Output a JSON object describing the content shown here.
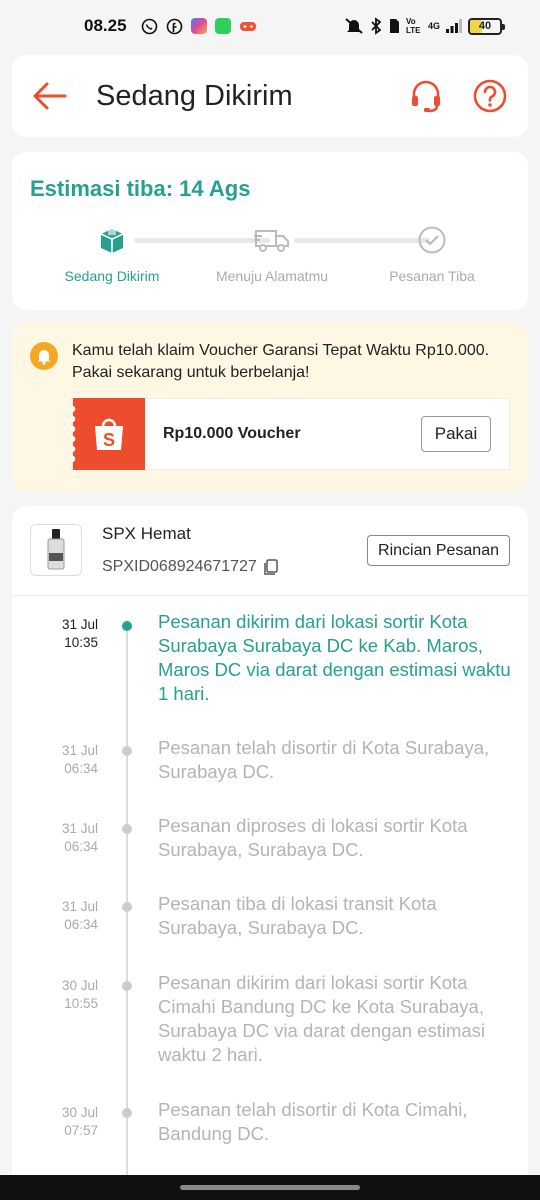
{
  "status_bar": {
    "time": "08.25",
    "battery": "40",
    "battery_level": 0.4,
    "network": "4G",
    "volte": "Vo LTE"
  },
  "header": {
    "title": "Sedang Dikirim",
    "back_icon": "arrow-left-icon",
    "support_icon": "headset-icon",
    "help_icon": "question-circle-icon",
    "accent_color": "#ee4d2d"
  },
  "shipment_status": {
    "eta": "Estimasi tiba: 14 Ags",
    "teal_color": "#26a08f",
    "steps": [
      {
        "label": "Sedang Dikirim",
        "icon": "box-icon",
        "active": true
      },
      {
        "label": "Menuju Alamatmu",
        "icon": "truck-icon",
        "active": false
      },
      {
        "label": "Pesanan Tiba",
        "icon": "check-circle-icon",
        "active": false
      }
    ]
  },
  "voucher": {
    "message": "Kamu telah klaim Voucher Garansi Tepat Waktu Rp10.000. Pakai sekarang untuk berbelanja!",
    "name": "Rp10.000 Voucher",
    "button": "Pakai",
    "logo_icon": "shopee-bag-icon",
    "bell_icon": "bell-icon"
  },
  "package": {
    "carrier": "SPX Hemat",
    "tracking_number": "SPXID068924671727",
    "details_button": "Rincian Pesanan",
    "copy_icon": "copy-icon"
  },
  "timeline": [
    {
      "date": "31 Jul",
      "time": "10:35",
      "text": "Pesanan dikirim dari lokasi sortir Kota Surabaya  Surabaya DC ke Kab. Maros, Maros DC via darat dengan estimasi waktu 1 hari.",
      "current": true
    },
    {
      "date": "31 Jul",
      "time": "06:34",
      "text": "Pesanan telah disortir di Kota Surabaya, Surabaya DC.",
      "current": false
    },
    {
      "date": "31 Jul",
      "time": "06:34",
      "text": "Pesanan diproses di lokasi sortir Kota Surabaya, Surabaya DC.",
      "current": false
    },
    {
      "date": "31 Jul",
      "time": "06:34",
      "text": "Pesanan tiba di lokasi transit Kota Surabaya, Surabaya DC.",
      "current": false
    },
    {
      "date": "30 Jul",
      "time": "10:55",
      "text": "Pesanan dikirim dari lokasi sortir Kota Cimahi  Bandung DC ke Kota Surabaya, Surabaya DC via darat dengan estimasi waktu 2 hari.",
      "current": false
    },
    {
      "date": "30 Jul",
      "time": "07:57",
      "text": "Pesanan telah disortir di Kota Cimahi, Bandung DC.",
      "current": false
    }
  ]
}
